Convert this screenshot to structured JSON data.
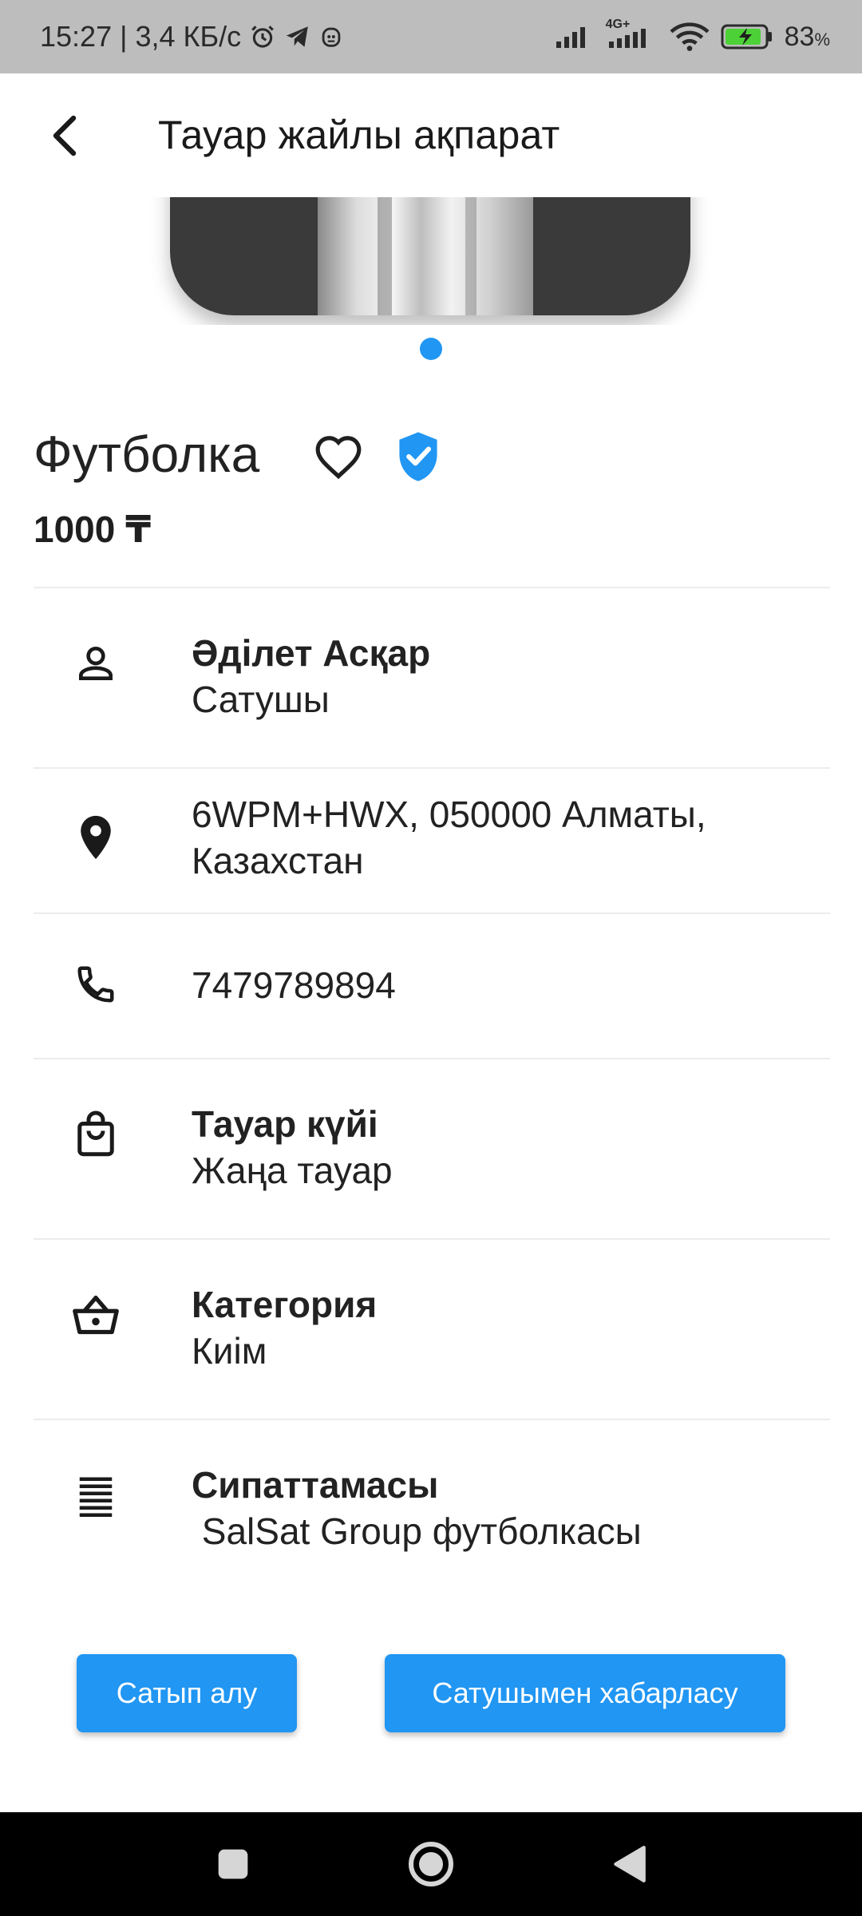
{
  "status_bar": {
    "time": "15:27",
    "speed": "| 3,4 КБ/с",
    "network_label": "4G+",
    "battery_percent": "83",
    "battery_unit": "%",
    "icons": [
      "alarm-icon",
      "telegram-icon",
      "app-notification-icon",
      "signal-icon",
      "signal-4g-icon",
      "wifi-icon",
      "battery-charging-icon"
    ]
  },
  "app_bar": {
    "title": "Тауар жайлы ақпарат",
    "back_icon": "arrow-back-icon"
  },
  "carousel": {
    "page_count": 1,
    "active_index": 0,
    "accent_color": "#2196f3"
  },
  "product": {
    "title": "Футболка",
    "price": "1000 ₸",
    "favorite_icon": "heart-outline-icon",
    "verified_icon": "verified-shield-icon",
    "verified_color": "#2196f3"
  },
  "details": {
    "seller": {
      "name": "Әділет Асқар",
      "role": "Сатушы",
      "icon": "person-icon"
    },
    "address": {
      "line1": "6WPM+HWX, 050000 Алматы,",
      "line2": "Казахстан",
      "icon": "location-pin-icon"
    },
    "phone": {
      "value": "7479789894",
      "icon": "phone-icon"
    },
    "condition": {
      "label": "Тауар күйі",
      "value": "Жаңа тауар",
      "icon": "shopping-bag-icon"
    },
    "category": {
      "label": "Категория",
      "value": "Киім",
      "icon": "basket-icon"
    },
    "description": {
      "label": "Сипаттамасы",
      "value": " SalSat Group футболкасы",
      "icon": "notes-icon"
    }
  },
  "actions": {
    "buy_label": "Сатып алу",
    "contact_label": "Сатушымен хабарласу",
    "button_color": "#2196f3"
  },
  "nav_bar": {
    "icons": [
      "recents-square-icon",
      "home-circle-icon",
      "back-triangle-icon"
    ]
  }
}
